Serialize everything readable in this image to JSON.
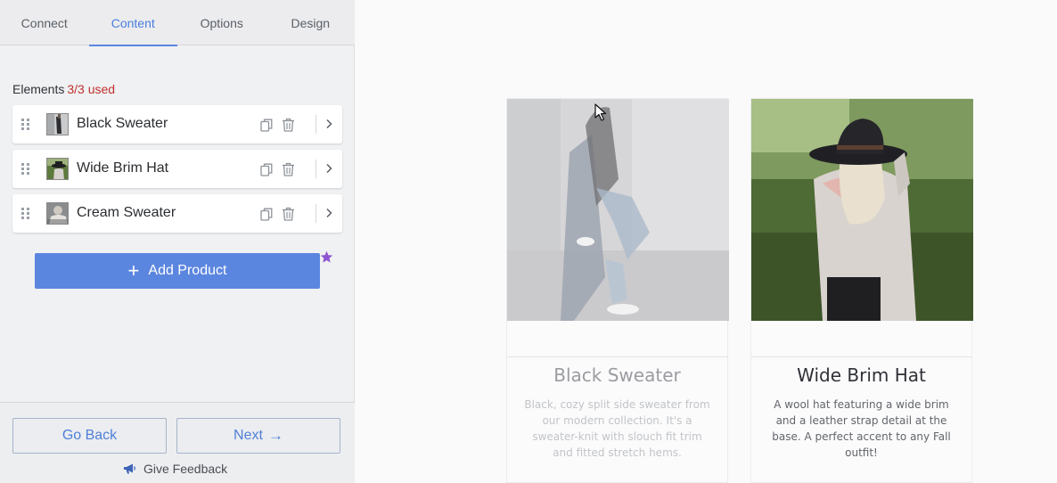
{
  "tabs": [
    {
      "label": "Connect",
      "active": false
    },
    {
      "label": "Content",
      "active": true
    },
    {
      "label": "Options",
      "active": false
    },
    {
      "label": "Design",
      "active": false
    }
  ],
  "elements": {
    "heading": "Elements",
    "used": "3/3 used",
    "items": [
      {
        "name": "Black Sweater"
      },
      {
        "name": "Wide Brim Hat"
      },
      {
        "name": "Cream Sweater"
      }
    ]
  },
  "add_product_label": "Add Product",
  "footer": {
    "go_back": "Go Back",
    "next": "Next",
    "next_arrow": "→",
    "feedback": "Give Feedback"
  },
  "preview": {
    "cards": [
      {
        "title": "Black Sweater",
        "description": "Black, cozy split side sweater from our modern collection. It's a sweater-knit with slouch fit trim and fitted stretch hems."
      },
      {
        "title": "Wide Brim Hat",
        "description": "A wool hat featuring a wide brim and a leather strap detail at the base. A perfect accent to any Fall outfit!"
      }
    ]
  },
  "colors": {
    "accent": "#5b86e0",
    "used_badge": "#c0302e",
    "star": "#8e55d1"
  },
  "icons": {
    "drag": "drag-handle-icon",
    "copy": "copy-icon",
    "delete": "trash-icon",
    "open": "chevron-right-icon",
    "add": "plus-icon",
    "premium": "star-icon",
    "feedback": "megaphone-icon",
    "cursor": "mouse-pointer-icon"
  }
}
